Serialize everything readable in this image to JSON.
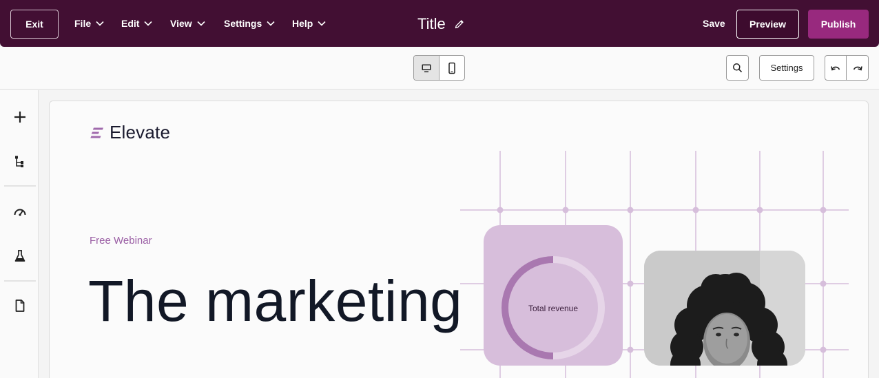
{
  "topbar": {
    "exit_label": "Exit",
    "menus": [
      "File",
      "Edit",
      "View",
      "Settings",
      "Help"
    ],
    "title": "Title",
    "save_label": "Save",
    "preview_label": "Preview",
    "publish_label": "Publish"
  },
  "toolbar": {
    "settings_label": "Settings"
  },
  "page": {
    "logo_text": "Elevate",
    "eyebrow": "Free Webinar",
    "headline": "The marketing",
    "card_label": "Total revenue"
  },
  "colors": {
    "topbar_bg": "#420f33",
    "publish_bg": "#98297e",
    "accent": "#9a5ea4",
    "card_bg": "#d7bedb"
  }
}
